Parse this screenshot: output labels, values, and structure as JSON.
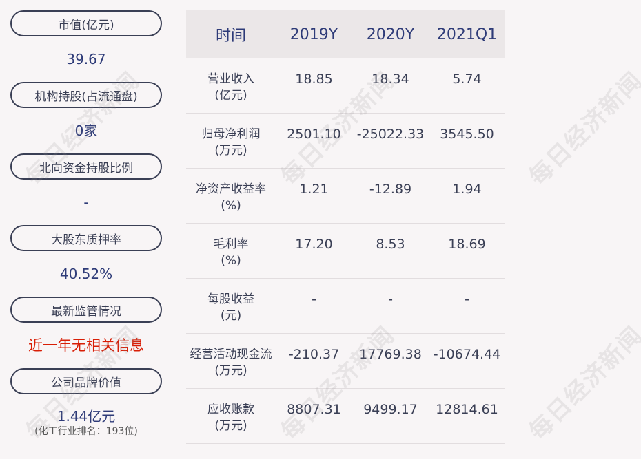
{
  "left": {
    "items": [
      {
        "label": "市值(亿元)",
        "value": "39.67"
      },
      {
        "label": "机构持股(占流通盘)",
        "value": "0家"
      },
      {
        "label": "北向资金持股比例",
        "value": "-"
      },
      {
        "label": "大股东质押率",
        "value": "40.52%"
      },
      {
        "label": "最新监管情况",
        "value": "近一年无相关信息"
      },
      {
        "label": "公司品牌价值",
        "value": "1.44亿元",
        "sub": "(化工行业排名：193位)"
      }
    ]
  },
  "table": {
    "headers": [
      "时间",
      "2019Y",
      "2020Y",
      "2021Q1"
    ],
    "rows": [
      {
        "label1": "营业收入",
        "label2": "(亿元)",
        "v": [
          "18.85",
          "18.34",
          "5.74"
        ]
      },
      {
        "label1": "归母净利润",
        "label2": "(万元)",
        "v": [
          "2501.10",
          "-25022.33",
          "3545.50"
        ]
      },
      {
        "label1": "净资产收益率",
        "label2": "(%)",
        "v": [
          "1.21",
          "-12.89",
          "1.94"
        ]
      },
      {
        "label1": "毛利率",
        "label2": "(%)",
        "v": [
          "17.20",
          "8.53",
          "18.69"
        ]
      },
      {
        "label1": "每股收益",
        "label2": "(元)",
        "v": [
          "-",
          "-",
          "-"
        ]
      },
      {
        "label1": "经营活动现金流",
        "label2": "(万元)",
        "v": [
          "-210.37",
          "17769.38",
          "-10674.44"
        ]
      },
      {
        "label1": "应收账款",
        "label2": "(万元)",
        "v": [
          "8807.31",
          "9499.17",
          "12814.61"
        ]
      }
    ]
  },
  "watermark": "每日经济新闻",
  "colors": {
    "value_blue": "#2e3b78",
    "alert_red": "#d81e06",
    "border": "#3a3f55",
    "header_bg": "#ebe7e8"
  }
}
